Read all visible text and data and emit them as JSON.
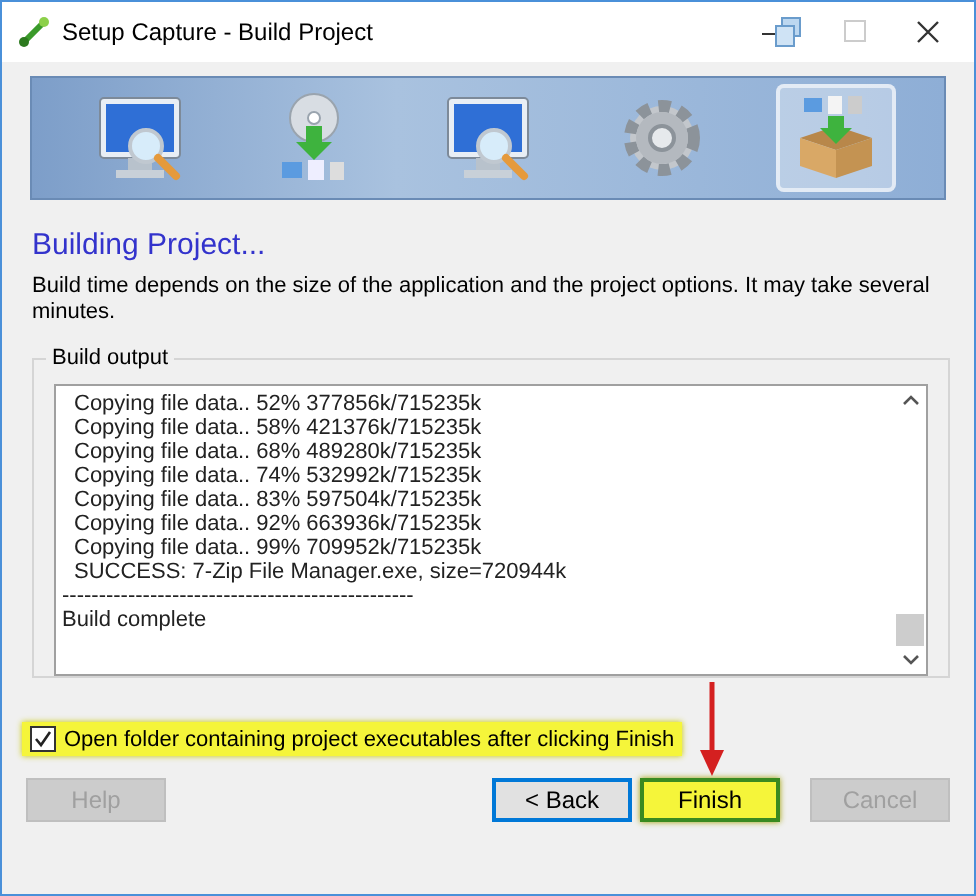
{
  "window": {
    "title": "Setup Capture - Build Project"
  },
  "steps": [
    {
      "kind": "monitor-search",
      "selected": false
    },
    {
      "kind": "disc-install",
      "selected": false
    },
    {
      "kind": "monitor-search",
      "selected": false
    },
    {
      "kind": "gear",
      "selected": false
    },
    {
      "kind": "package",
      "selected": true
    }
  ],
  "heading": "Building Project...",
  "description": "Build time depends on the size of the application and the project options. It may take several minutes.",
  "output": {
    "label": "Build output",
    "lines": [
      {
        "text": "Copying file data.. 52% 377856k/715235k",
        "indented": true
      },
      {
        "text": "Copying file data.. 58% 421376k/715235k",
        "indented": true
      },
      {
        "text": "Copying file data.. 68% 489280k/715235k",
        "indented": true
      },
      {
        "text": "Copying file data.. 74% 532992k/715235k",
        "indented": true
      },
      {
        "text": "Copying file data.. 83% 597504k/715235k",
        "indented": true
      },
      {
        "text": "Copying file data.. 92% 663936k/715235k",
        "indented": true
      },
      {
        "text": "Copying file data.. 99% 709952k/715235k",
        "indented": true
      },
      {
        "text": "SUCCESS: 7-Zip File Manager.exe, size=720944k",
        "indented": true
      },
      {
        "text": "------------------------------------------------",
        "indented": false
      },
      {
        "text": "Build complete",
        "indented": false
      }
    ]
  },
  "open_folder": {
    "label": "Open folder containing project executables after clicking Finish",
    "checked": true,
    "highlighted": true
  },
  "buttons": [
    {
      "label": "Help",
      "disabled": true,
      "focused": false,
      "highlighted": false,
      "callout_arrow": false
    },
    {
      "label": "< Back",
      "disabled": false,
      "focused": true,
      "highlighted": false,
      "callout_arrow": false
    },
    {
      "label": "Finish",
      "disabled": false,
      "focused": false,
      "highlighted": true,
      "callout_arrow": true
    },
    {
      "label": "Cancel",
      "disabled": true,
      "focused": false,
      "highlighted": false,
      "callout_arrow": false
    }
  ]
}
